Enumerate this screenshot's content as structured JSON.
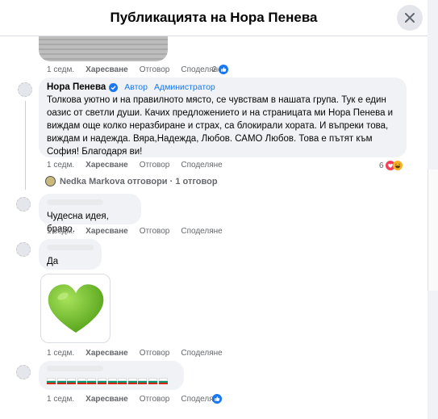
{
  "header": {
    "title": "Публикацията на Нора Пенева"
  },
  "colors": {
    "like_blue": "#1877f2",
    "link_blue": "#1877f2",
    "muted": "#65676b",
    "bubble": "#f0f2f5",
    "heart_green": "#6bbf2a"
  },
  "top_post": {
    "time": "1 седм.",
    "like": "Харесване",
    "reply": "Отговор",
    "share": "Споделяне",
    "reactions": "2"
  },
  "main_comment": {
    "author": "Нора Пенева",
    "badge_icon": "verified-icon",
    "role1": "Автор",
    "role2": "Администратор",
    "text": "Толкова уютно и на правилното място, се чувствам в нашата група. Тук е един оазис от светли души. Качих предложението и на страницата ми Нора Пенева и виждам още колко неразбиране и страх, са блокирали хората. И въпреки това, виждам и надежда. Вяра,Надежда, Любов. САМО Любов. Това е пътят към София! Благодаря ви!",
    "time": "1 седм.",
    "like": "Харесване",
    "reply": "Отговор",
    "share": "Споделяне",
    "reactions": "6"
  },
  "replies_toggle": {
    "text": "Nedka Markova отговори · 1 отговор"
  },
  "comments": [
    {
      "text": "Чудесна идея, браво.",
      "time": "1 седм.",
      "like": "Харесване",
      "reply": "Отговор",
      "share": "Споделяне"
    },
    {
      "text": "Да",
      "time": "",
      "like": "",
      "reply": "",
      "share": ""
    },
    {
      "time": "1 седм.",
      "like": "Харесване",
      "reply": "Отговор",
      "share": "Споделяне",
      "sticker": "green-heart-icon"
    },
    {
      "flags": "bulgarian-flag-icon",
      "time": "1 седм.",
      "like": "Харесване",
      "reply": "Отговор",
      "share": "Споделяне",
      "reactions": ""
    }
  ]
}
